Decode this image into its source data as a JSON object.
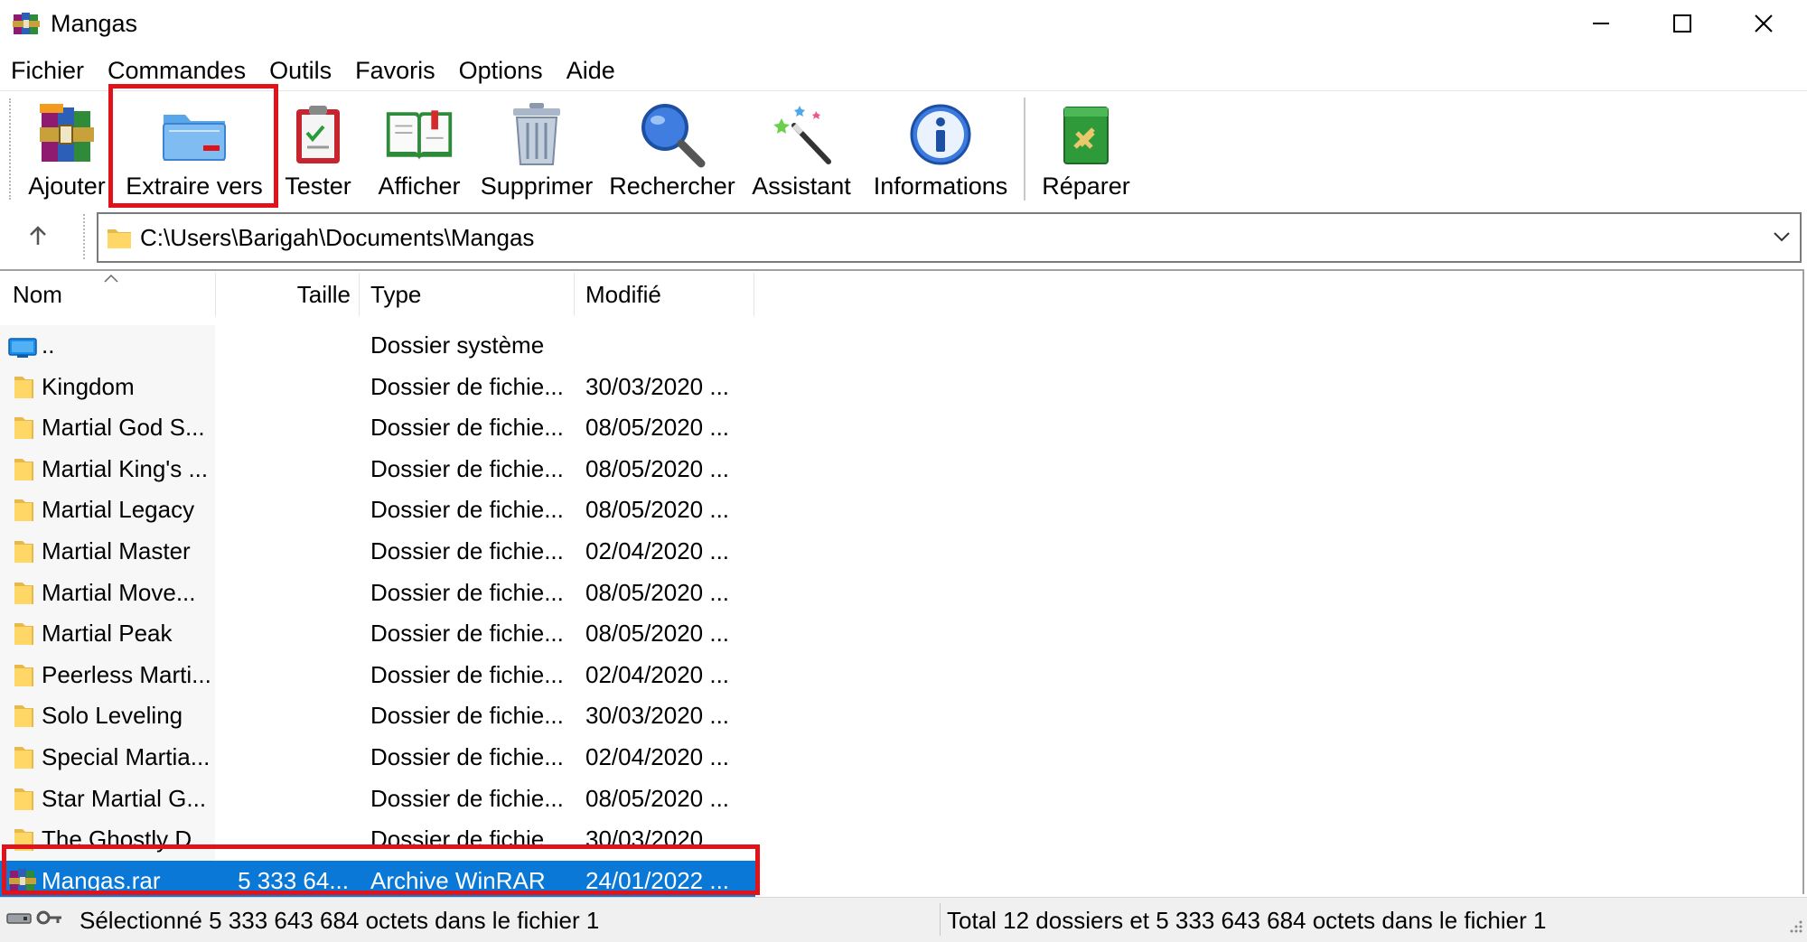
{
  "window": {
    "title": "Mangas",
    "app_icon": "winrar-icon"
  },
  "menu": [
    "Fichier",
    "Commandes",
    "Outils",
    "Favoris",
    "Options",
    "Aide"
  ],
  "toolbar": {
    "buttons": [
      {
        "label": "Ajouter",
        "icon": "add-archive-icon"
      },
      {
        "label": "Extraire vers",
        "icon": "extract-folder-icon"
      },
      {
        "label": "Tester",
        "icon": "test-clipboard-icon"
      },
      {
        "label": "Afficher",
        "icon": "book-icon"
      },
      {
        "label": "Supprimer",
        "icon": "trash-icon"
      },
      {
        "label": "Rechercher",
        "icon": "magnifier-icon"
      },
      {
        "label": "Assistant",
        "icon": "magic-wand-icon"
      },
      {
        "label": "Informations",
        "icon": "info-icon"
      },
      {
        "label": "Réparer",
        "icon": "repair-kit-icon"
      }
    ]
  },
  "address": {
    "path": "C:\\Users\\Barigah\\Documents\\Mangas"
  },
  "columns": {
    "name": "Nom",
    "size": "Taille",
    "type": "Type",
    "modified": "Modifié"
  },
  "rows": [
    {
      "name": "..",
      "size": "",
      "type": "Dossier système",
      "modified": "",
      "icon": "system-folder-icon"
    },
    {
      "name": "Kingdom",
      "size": "",
      "type": "Dossier de fichie...",
      "modified": "30/03/2020 ...",
      "icon": "folder-icon"
    },
    {
      "name": "Martial God S...",
      "size": "",
      "type": "Dossier de fichie...",
      "modified": "08/05/2020 ...",
      "icon": "folder-icon"
    },
    {
      "name": "Martial King's ...",
      "size": "",
      "type": "Dossier de fichie...",
      "modified": "08/05/2020 ...",
      "icon": "folder-icon"
    },
    {
      "name": "Martial Legacy",
      "size": "",
      "type": "Dossier de fichie...",
      "modified": "08/05/2020 ...",
      "icon": "folder-icon"
    },
    {
      "name": "Martial Master",
      "size": "",
      "type": "Dossier de fichie...",
      "modified": "02/04/2020 ...",
      "icon": "folder-icon"
    },
    {
      "name": "Martial Move...",
      "size": "",
      "type": "Dossier de fichie...",
      "modified": "08/05/2020 ...",
      "icon": "folder-icon"
    },
    {
      "name": "Martial Peak",
      "size": "",
      "type": "Dossier de fichie...",
      "modified": "08/05/2020 ...",
      "icon": "folder-icon"
    },
    {
      "name": "Peerless Marti...",
      "size": "",
      "type": "Dossier de fichie...",
      "modified": "02/04/2020 ...",
      "icon": "folder-icon"
    },
    {
      "name": "Solo Leveling",
      "size": "",
      "type": "Dossier de fichie...",
      "modified": "30/03/2020 ...",
      "icon": "folder-icon"
    },
    {
      "name": "Special Martia...",
      "size": "",
      "type": "Dossier de fichie...",
      "modified": "02/04/2020 ...",
      "icon": "folder-icon"
    },
    {
      "name": "Star Martial G...",
      "size": "",
      "type": "Dossier de fichie...",
      "modified": "08/05/2020 ...",
      "icon": "folder-icon"
    },
    {
      "name": "The Ghostly D...",
      "size": "",
      "type": "Dossier de fichie...",
      "modified": "30/03/2020 ...",
      "icon": "folder-icon"
    },
    {
      "name": "Mangas.rar",
      "size": "5 333 64...",
      "type": "Archive WinRAR",
      "modified": "24/01/2022 ...",
      "icon": "rar-archive-icon",
      "selected": true
    }
  ],
  "status": {
    "left": "Sélectionné 5 333 643 684 octets dans le fichier 1",
    "right": "Total 12 dossiers et 5 333 643 684 octets dans le fichier 1"
  },
  "colors": {
    "selection": "#0a78d7",
    "highlight_box": "#e0131b",
    "folder": "#ffd766"
  }
}
